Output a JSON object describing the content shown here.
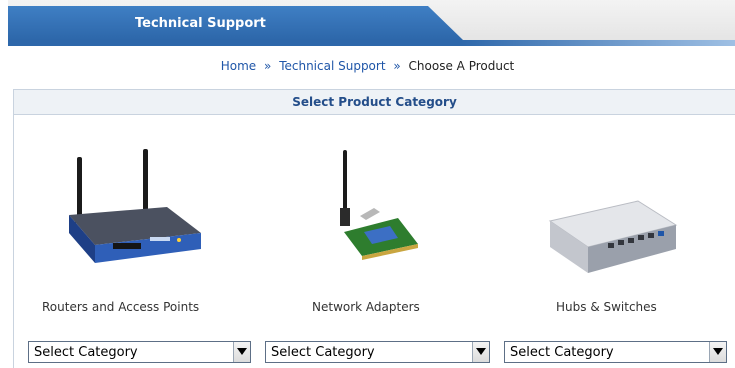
{
  "header": {
    "title": "Technical Support"
  },
  "breadcrumb": {
    "home": "Home",
    "sep": "»",
    "support": "Technical Support",
    "current": "Choose A Product"
  },
  "panel": {
    "title": "Select Product Category"
  },
  "products": [
    {
      "label": "Routers and Access Points",
      "select_value": "Select Category"
    },
    {
      "label": "Network Adapters",
      "select_value": "Select Category"
    },
    {
      "label": "Hubs & Switches",
      "select_value": "Select Category"
    }
  ],
  "colors": {
    "header_blue": "#2d67aa",
    "link_blue": "#1f56a8",
    "panel_title": "#244e8a"
  }
}
